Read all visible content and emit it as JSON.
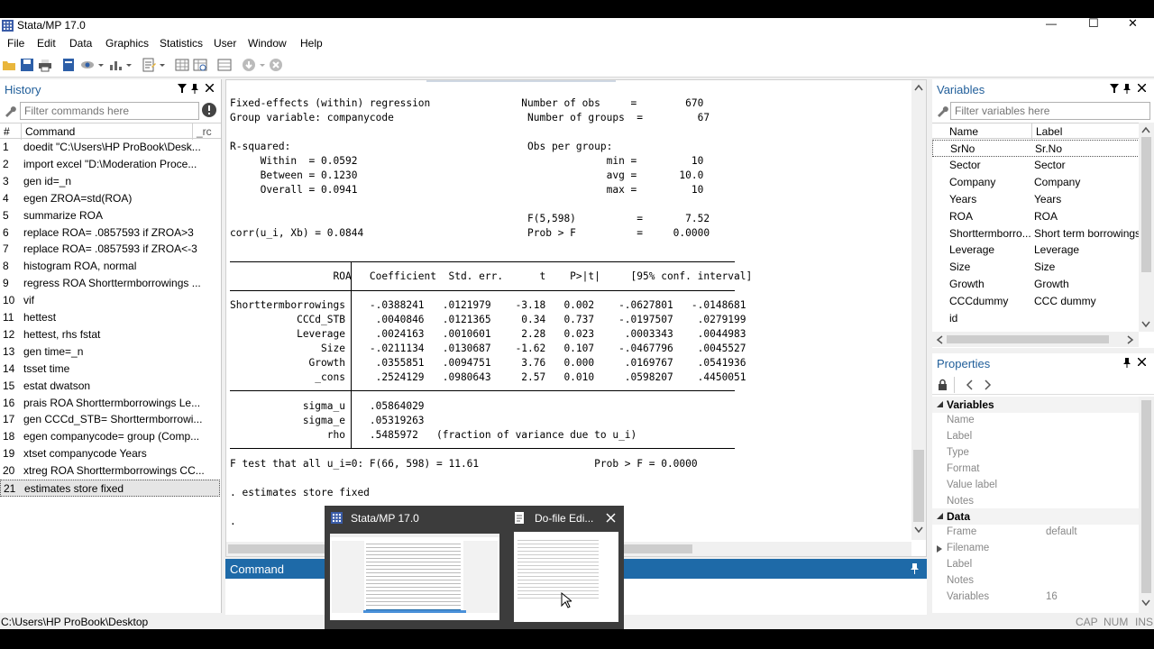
{
  "window": {
    "title": "Stata/MP 17.0",
    "minimize": "—",
    "maximize": "☐",
    "close": "✕"
  },
  "menu": [
    "File",
    "Edit",
    "Data",
    "Graphics",
    "Statistics",
    "User",
    "Window",
    "Help"
  ],
  "history": {
    "title": "History",
    "filter_placeholder": "Filter commands here",
    "col_num": "#",
    "col_command": "Command",
    "col_rc": "_rc",
    "items": [
      {
        "n": "1",
        "cmd": "doedit \"C:\\Users\\HP ProBook\\Desk..."
      },
      {
        "n": "2",
        "cmd": "import excel \"D:\\Moderation Proce..."
      },
      {
        "n": "3",
        "cmd": "gen id=_n"
      },
      {
        "n": "4",
        "cmd": "egen ZROA=std(ROA)"
      },
      {
        "n": "5",
        "cmd": "summarize ROA"
      },
      {
        "n": "6",
        "cmd": "replace ROA= .0857593 if ZROA>3"
      },
      {
        "n": "7",
        "cmd": "replace ROA= .0857593 if ZROA<-3"
      },
      {
        "n": "8",
        "cmd": "histogram ROA, normal"
      },
      {
        "n": "9",
        "cmd": "regress ROA Shorttermborrowings ..."
      },
      {
        "n": "10",
        "cmd": "vif"
      },
      {
        "n": "11",
        "cmd": "hettest"
      },
      {
        "n": "12",
        "cmd": "hettest, rhs fstat"
      },
      {
        "n": "13",
        "cmd": "gen time=_n"
      },
      {
        "n": "14",
        "cmd": "tsset time"
      },
      {
        "n": "15",
        "cmd": "estat dwatson"
      },
      {
        "n": "16",
        "cmd": "prais ROA Shorttermborrowings Le..."
      },
      {
        "n": "17",
        "cmd": "gen CCCd_STB= Shorttermborrowi..."
      },
      {
        "n": "18",
        "cmd": "egen companycode= group (Comp..."
      },
      {
        "n": "19",
        "cmd": "xtset companycode Years"
      },
      {
        "n": "20",
        "cmd": "xtreg ROA Shorttermborrowings CC..."
      },
      {
        "n": "21",
        "cmd": "estimates store fixed"
      }
    ]
  },
  "results": {
    "text": "Fixed-effects (within) regression               Number of obs     =        670\nGroup variable: companycode                      Number of groups  =         67\n\nR-squared:                                       Obs per group:\n     Within  = 0.0592                                         min =         10\n     Between = 0.1230                                         avg =       10.0\n     Overall = 0.0941                                         max =         10\n\n                                                 F(5,598)          =       7.52\ncorr(u_i, Xb) = 0.0844                           Prob > F          =     0.0000\n\n\n                 ROA   Coefficient  Std. err.      t    P>|t|     [95% conf. interval]\n\nShorttermborrowings    -.0388241   .0121979    -3.18   0.002    -.0627801   -.0148681\n           CCCd_STB     .0040846   .0121365     0.34   0.737    -.0197507    .0279199\n           Leverage     .0024163   .0010601     2.28   0.023     .0003343    .0044983\n               Size    -.0211134   .0130687    -1.62   0.107    -.0467796    .0045527\n             Growth     .0355851   .0094751     3.76   0.000     .0169767    .0541936\n              _cons     .2524129   .0980643     2.57   0.010     .0598207    .4450051\n\n            sigma_u    .05864029\n            sigma_e    .05319263\n                rho    .5485972   (fraction of variance due to u_i)\n\nF test that all u_i=0: F(66, 598) = 11.61                   Prob > F = 0.0000\n\n. estimates store fixed\n\n."
  },
  "command": {
    "title": "Command"
  },
  "variables": {
    "title": "Variables",
    "filter_placeholder": "Filter variables here",
    "col_name": "Name",
    "col_label": "Label",
    "items": [
      {
        "name": "SrNo",
        "label": "Sr.No"
      },
      {
        "name": "Sector",
        "label": "Sector"
      },
      {
        "name": "Company",
        "label": "Company"
      },
      {
        "name": "Years",
        "label": "Years"
      },
      {
        "name": "ROA",
        "label": "ROA"
      },
      {
        "name": "Shorttermborro...",
        "label": "Short term borrowings"
      },
      {
        "name": "Leverage",
        "label": "Leverage"
      },
      {
        "name": "Size",
        "label": "Size"
      },
      {
        "name": "Growth",
        "label": "Growth"
      },
      {
        "name": "CCCdummy",
        "label": "CCC dummy"
      },
      {
        "name": "id",
        "label": ""
      }
    ]
  },
  "properties": {
    "title": "Properties",
    "sec_variables": "Variables",
    "variables_rows": [
      {
        "name": "Name",
        "value": ""
      },
      {
        "name": "Label",
        "value": ""
      },
      {
        "name": "Type",
        "value": ""
      },
      {
        "name": "Format",
        "value": ""
      },
      {
        "name": "Value label",
        "value": ""
      },
      {
        "name": "Notes",
        "value": ""
      }
    ],
    "sec_data": "Data",
    "data_rows": [
      {
        "name": "Frame",
        "value": "default"
      },
      {
        "name": "Filename",
        "value": ""
      },
      {
        "name": "Label",
        "value": ""
      },
      {
        "name": "Notes",
        "value": ""
      },
      {
        "name": "Variables",
        "value": "16"
      }
    ]
  },
  "status": {
    "path": "C:\\Users\\HP ProBook\\Desktop",
    "cap": "CAP",
    "num": "NUM",
    "ins": "INS"
  },
  "taskbar_preview": {
    "item1": "Stata/MP 17.0",
    "item2": "Do-file Edi..."
  },
  "colors": {
    "accent": "#1e6aa8",
    "panel_title": "#1f5d99"
  }
}
